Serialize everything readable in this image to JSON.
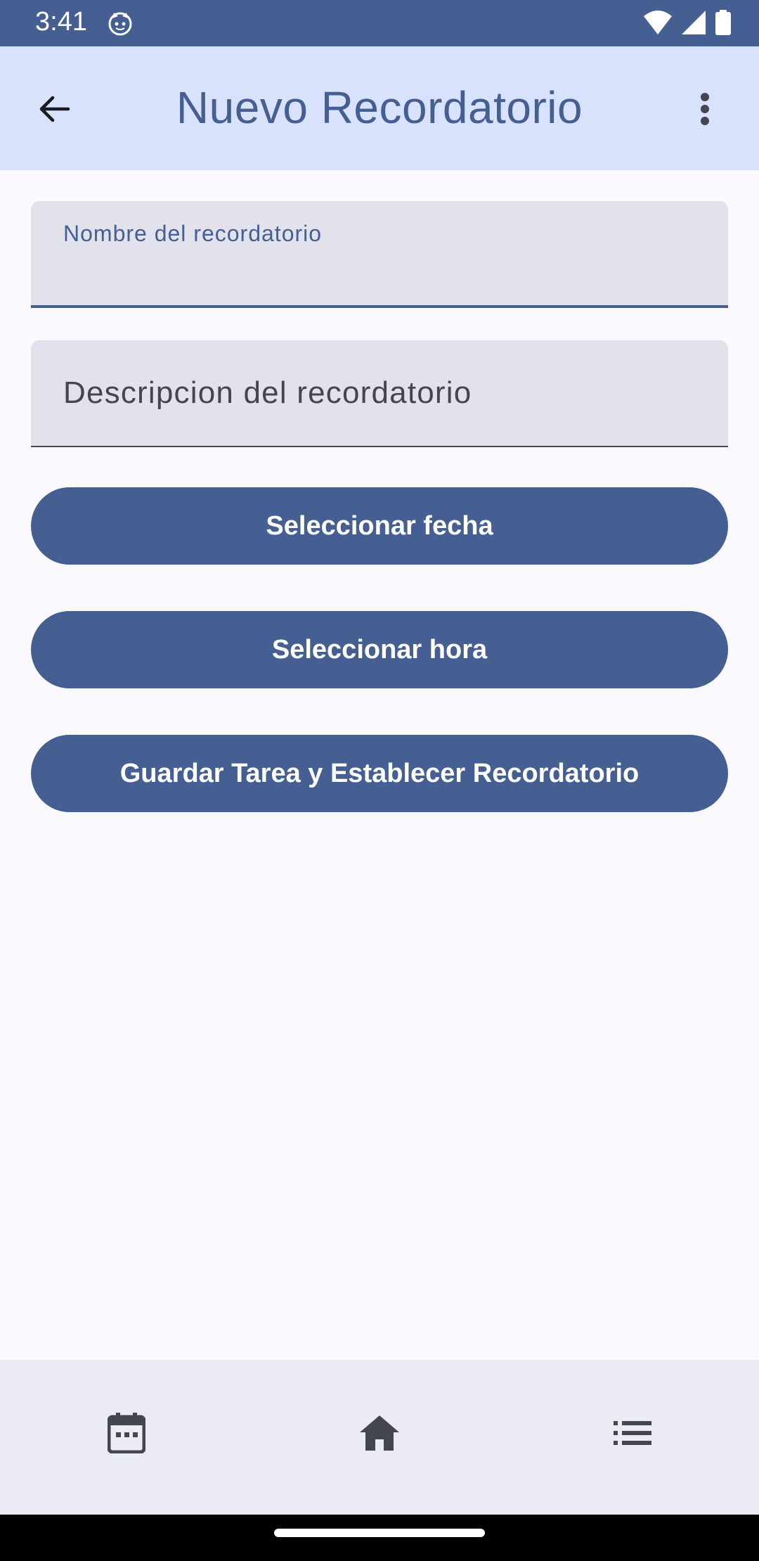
{
  "status_bar": {
    "time": "3:41",
    "icons": [
      "cat-notification-icon",
      "wifi-icon",
      "signal-icon",
      "battery-icon"
    ]
  },
  "app_bar": {
    "title": "Nuevo Recordatorio",
    "back_icon": "arrow-back-icon",
    "menu_icon": "more-vert-icon"
  },
  "form": {
    "name_field": {
      "label": "Nombre del recordatorio",
      "value": ""
    },
    "description_field": {
      "placeholder": "Descripcion del recordatorio",
      "value": ""
    }
  },
  "buttons": {
    "select_date": "Seleccionar fecha",
    "select_time": "Seleccionar hora",
    "save": "Guardar Tarea y Establecer Recordatorio"
  },
  "bottom_nav": {
    "items": [
      {
        "icon": "calendar-icon"
      },
      {
        "icon": "home-icon"
      },
      {
        "icon": "list-icon"
      }
    ]
  },
  "colors": {
    "primary": "#455f92",
    "app_bar_bg": "#d8e2fc",
    "field_bg": "#e1e2ec",
    "background": "#f9f9fe",
    "nav_bg": "#ebebf4"
  }
}
